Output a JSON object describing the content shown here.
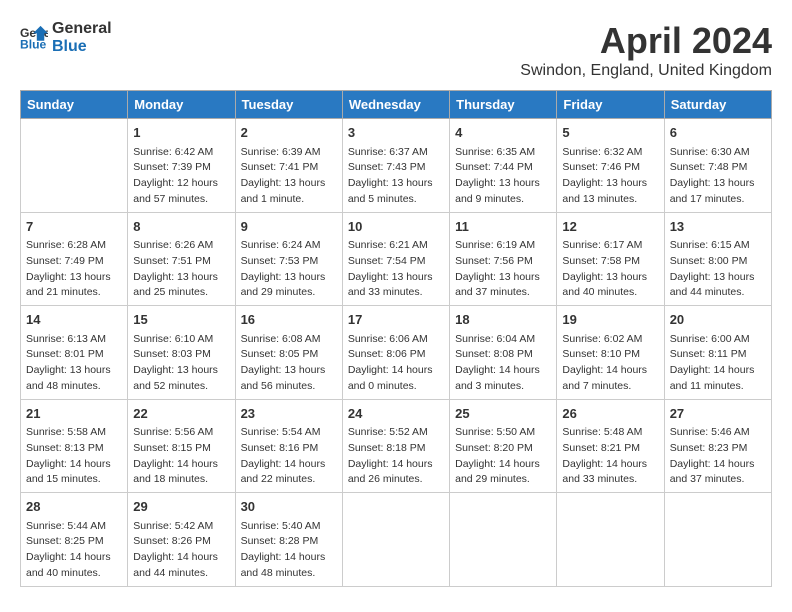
{
  "header": {
    "logo_general": "General",
    "logo_blue": "Blue",
    "title": "April 2024",
    "subtitle": "Swindon, England, United Kingdom"
  },
  "weekdays": [
    "Sunday",
    "Monday",
    "Tuesday",
    "Wednesday",
    "Thursday",
    "Friday",
    "Saturday"
  ],
  "weeks": [
    [
      {
        "day": "",
        "sunrise": "",
        "sunset": "",
        "daylight": ""
      },
      {
        "day": "1",
        "sunrise": "Sunrise: 6:42 AM",
        "sunset": "Sunset: 7:39 PM",
        "daylight": "Daylight: 12 hours and 57 minutes."
      },
      {
        "day": "2",
        "sunrise": "Sunrise: 6:39 AM",
        "sunset": "Sunset: 7:41 PM",
        "daylight": "Daylight: 13 hours and 1 minute."
      },
      {
        "day": "3",
        "sunrise": "Sunrise: 6:37 AM",
        "sunset": "Sunset: 7:43 PM",
        "daylight": "Daylight: 13 hours and 5 minutes."
      },
      {
        "day": "4",
        "sunrise": "Sunrise: 6:35 AM",
        "sunset": "Sunset: 7:44 PM",
        "daylight": "Daylight: 13 hours and 9 minutes."
      },
      {
        "day": "5",
        "sunrise": "Sunrise: 6:32 AM",
        "sunset": "Sunset: 7:46 PM",
        "daylight": "Daylight: 13 hours and 13 minutes."
      },
      {
        "day": "6",
        "sunrise": "Sunrise: 6:30 AM",
        "sunset": "Sunset: 7:48 PM",
        "daylight": "Daylight: 13 hours and 17 minutes."
      }
    ],
    [
      {
        "day": "7",
        "sunrise": "Sunrise: 6:28 AM",
        "sunset": "Sunset: 7:49 PM",
        "daylight": "Daylight: 13 hours and 21 minutes."
      },
      {
        "day": "8",
        "sunrise": "Sunrise: 6:26 AM",
        "sunset": "Sunset: 7:51 PM",
        "daylight": "Daylight: 13 hours and 25 minutes."
      },
      {
        "day": "9",
        "sunrise": "Sunrise: 6:24 AM",
        "sunset": "Sunset: 7:53 PM",
        "daylight": "Daylight: 13 hours and 29 minutes."
      },
      {
        "day": "10",
        "sunrise": "Sunrise: 6:21 AM",
        "sunset": "Sunset: 7:54 PM",
        "daylight": "Daylight: 13 hours and 33 minutes."
      },
      {
        "day": "11",
        "sunrise": "Sunrise: 6:19 AM",
        "sunset": "Sunset: 7:56 PM",
        "daylight": "Daylight: 13 hours and 37 minutes."
      },
      {
        "day": "12",
        "sunrise": "Sunrise: 6:17 AM",
        "sunset": "Sunset: 7:58 PM",
        "daylight": "Daylight: 13 hours and 40 minutes."
      },
      {
        "day": "13",
        "sunrise": "Sunrise: 6:15 AM",
        "sunset": "Sunset: 8:00 PM",
        "daylight": "Daylight: 13 hours and 44 minutes."
      }
    ],
    [
      {
        "day": "14",
        "sunrise": "Sunrise: 6:13 AM",
        "sunset": "Sunset: 8:01 PM",
        "daylight": "Daylight: 13 hours and 48 minutes."
      },
      {
        "day": "15",
        "sunrise": "Sunrise: 6:10 AM",
        "sunset": "Sunset: 8:03 PM",
        "daylight": "Daylight: 13 hours and 52 minutes."
      },
      {
        "day": "16",
        "sunrise": "Sunrise: 6:08 AM",
        "sunset": "Sunset: 8:05 PM",
        "daylight": "Daylight: 13 hours and 56 minutes."
      },
      {
        "day": "17",
        "sunrise": "Sunrise: 6:06 AM",
        "sunset": "Sunset: 8:06 PM",
        "daylight": "Daylight: 14 hours and 0 minutes."
      },
      {
        "day": "18",
        "sunrise": "Sunrise: 6:04 AM",
        "sunset": "Sunset: 8:08 PM",
        "daylight": "Daylight: 14 hours and 3 minutes."
      },
      {
        "day": "19",
        "sunrise": "Sunrise: 6:02 AM",
        "sunset": "Sunset: 8:10 PM",
        "daylight": "Daylight: 14 hours and 7 minutes."
      },
      {
        "day": "20",
        "sunrise": "Sunrise: 6:00 AM",
        "sunset": "Sunset: 8:11 PM",
        "daylight": "Daylight: 14 hours and 11 minutes."
      }
    ],
    [
      {
        "day": "21",
        "sunrise": "Sunrise: 5:58 AM",
        "sunset": "Sunset: 8:13 PM",
        "daylight": "Daylight: 14 hours and 15 minutes."
      },
      {
        "day": "22",
        "sunrise": "Sunrise: 5:56 AM",
        "sunset": "Sunset: 8:15 PM",
        "daylight": "Daylight: 14 hours and 18 minutes."
      },
      {
        "day": "23",
        "sunrise": "Sunrise: 5:54 AM",
        "sunset": "Sunset: 8:16 PM",
        "daylight": "Daylight: 14 hours and 22 minutes."
      },
      {
        "day": "24",
        "sunrise": "Sunrise: 5:52 AM",
        "sunset": "Sunset: 8:18 PM",
        "daylight": "Daylight: 14 hours and 26 minutes."
      },
      {
        "day": "25",
        "sunrise": "Sunrise: 5:50 AM",
        "sunset": "Sunset: 8:20 PM",
        "daylight": "Daylight: 14 hours and 29 minutes."
      },
      {
        "day": "26",
        "sunrise": "Sunrise: 5:48 AM",
        "sunset": "Sunset: 8:21 PM",
        "daylight": "Daylight: 14 hours and 33 minutes."
      },
      {
        "day": "27",
        "sunrise": "Sunrise: 5:46 AM",
        "sunset": "Sunset: 8:23 PM",
        "daylight": "Daylight: 14 hours and 37 minutes."
      }
    ],
    [
      {
        "day": "28",
        "sunrise": "Sunrise: 5:44 AM",
        "sunset": "Sunset: 8:25 PM",
        "daylight": "Daylight: 14 hours and 40 minutes."
      },
      {
        "day": "29",
        "sunrise": "Sunrise: 5:42 AM",
        "sunset": "Sunset: 8:26 PM",
        "daylight": "Daylight: 14 hours and 44 minutes."
      },
      {
        "day": "30",
        "sunrise": "Sunrise: 5:40 AM",
        "sunset": "Sunset: 8:28 PM",
        "daylight": "Daylight: 14 hours and 48 minutes."
      },
      {
        "day": "",
        "sunrise": "",
        "sunset": "",
        "daylight": ""
      },
      {
        "day": "",
        "sunrise": "",
        "sunset": "",
        "daylight": ""
      },
      {
        "day": "",
        "sunrise": "",
        "sunset": "",
        "daylight": ""
      },
      {
        "day": "",
        "sunrise": "",
        "sunset": "",
        "daylight": ""
      }
    ]
  ]
}
